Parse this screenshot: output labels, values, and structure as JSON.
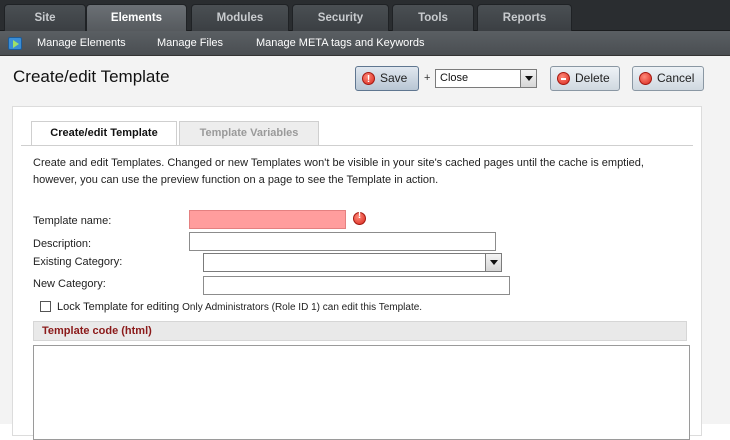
{
  "top_tabs": [
    "Site",
    "Elements",
    "Modules",
    "Security",
    "Tools",
    "Reports"
  ],
  "active_top_tab": "Elements",
  "subnav": {
    "manage_elements": "Manage Elements",
    "manage_files": "Manage Files",
    "manage_meta": "Manage META tags and Keywords"
  },
  "header": {
    "title": "Create/edit Template",
    "save_label": "Save",
    "plus": "+",
    "after_save_value": "Close",
    "delete_label": "Delete",
    "cancel_label": "Cancel"
  },
  "tabs": {
    "general": "Create/edit Template",
    "variables": "Template Variables"
  },
  "description": "Create and edit Templates. Changed or new Templates won't be visible in your site's cached pages until the cache is emptied, however, you can use the preview function on a page to see the Template in action.",
  "form": {
    "template_name_label": "Template name:",
    "template_name_value": "",
    "description_label": "Description:",
    "description_value": "",
    "existing_category_label": "Existing Category:",
    "existing_category_value": "",
    "new_category_label": "New Category:",
    "new_category_value": "",
    "lock_label": "Lock Template for editing",
    "lock_note": "Only Administrators (Role ID 1) can edit this Template.",
    "code_header": "Template code (html)"
  },
  "colors": {
    "error_field": "#ff9d9d",
    "code_header_text": "#8b1a1a",
    "topbar": "#2a2d30"
  }
}
